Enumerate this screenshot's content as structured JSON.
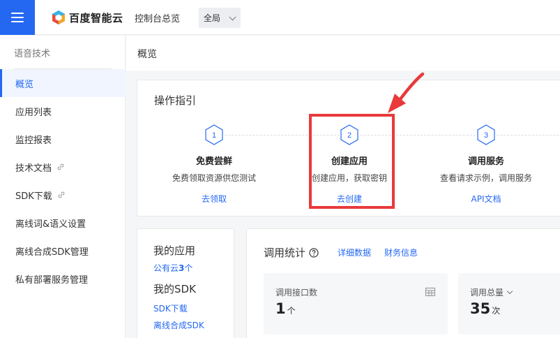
{
  "header": {
    "brand_name": "百度智能云",
    "console_label": "控制台总览",
    "region_value": "全局"
  },
  "sidebar": {
    "title": "语音技术",
    "items": [
      {
        "label": "概览"
      },
      {
        "label": "应用列表"
      },
      {
        "label": "监控报表"
      },
      {
        "label": "技术文档"
      },
      {
        "label": "SDK下载"
      },
      {
        "label": "离线词&语义设置"
      },
      {
        "label": "离线合成SDK管理"
      },
      {
        "label": "私有部署服务管理"
      }
    ]
  },
  "page": {
    "title": "概览"
  },
  "guide": {
    "title": "操作指引",
    "steps": [
      {
        "number": "1",
        "name": "免费尝鲜",
        "desc": "免费领取资源供您测试",
        "link": "去领取"
      },
      {
        "number": "2",
        "name": "创建应用",
        "desc": "创建应用，获取密钥",
        "link": "去创建"
      },
      {
        "number": "3",
        "name": "调用服务",
        "desc": "查看请求示例，调用服务",
        "link": "API文档"
      }
    ]
  },
  "my_apps": {
    "title": "我的应用",
    "public_cloud_prefix": "公有云",
    "public_cloud_count": "3",
    "public_cloud_suffix": "个",
    "sdk_title": "我的SDK",
    "sdk_download": "SDK下载",
    "offline_sdk": "离线合成SDK"
  },
  "stats": {
    "title": "调用统计",
    "detail_link": "详细数据",
    "finance_link": "财务信息",
    "api_count_label": "调用接口数",
    "api_count_value": "1",
    "api_count_unit": "个",
    "total_label": "调用总量",
    "total_value": "35",
    "total_unit": "次"
  },
  "colors": {
    "accent": "#2468f2",
    "highlight": "#e9393b"
  },
  "icons": {
    "menu": "hamburger-icon",
    "logo": "baidu-cloud-logo",
    "external": "link-icon",
    "help": "question-circle-icon",
    "table": "table-icon",
    "step": "hexagon-icon"
  }
}
